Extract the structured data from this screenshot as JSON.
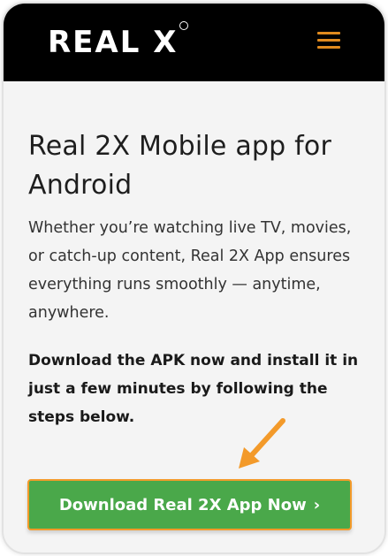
{
  "header": {
    "logo_text": "REAL X",
    "menu_icon": "hamburger-menu-icon"
  },
  "main": {
    "title": "Real 2X Mobile app for Android",
    "description": "Whether you’re watching live TV, movies, or catch-up content, Real 2X App ensures everything runs smoothly — anytime, anywhere.",
    "instructions": "Download the APK now and install it in just a few minutes by following the steps below."
  },
  "cta": {
    "label": "Download Real 2X App Now",
    "chevron": "›"
  },
  "annotation": {
    "arrow_icon": "pointer-arrow-icon"
  },
  "colors": {
    "header_bg": "#000000",
    "accent_orange": "#f39a2a",
    "button_green": "#4aa84a"
  }
}
